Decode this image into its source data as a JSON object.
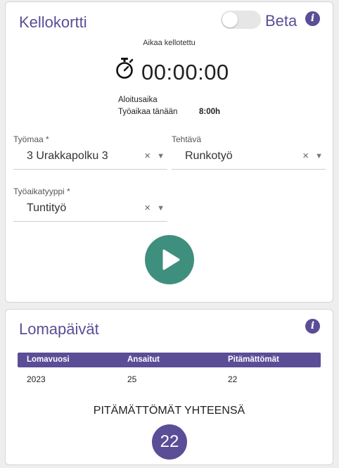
{
  "clock_card": {
    "title": "Kellokortti",
    "beta_label": "Beta",
    "beta_enabled": false,
    "info_icon": "i",
    "caption": "Aikaa kellotettu",
    "timer": "00:00:00",
    "start_time_label": "Aloitusaika",
    "start_time_value": "",
    "today_label": "Työaikaa tänään",
    "today_value": "8:00h",
    "fields": {
      "site": {
        "label": "Työmaa *",
        "value": "3 Urakkapolku 3",
        "clear": "×",
        "arrow": "▼"
      },
      "task": {
        "label": "Tehtävä",
        "value": "Runkotyö",
        "clear": "×",
        "arrow": "▼"
      },
      "worktype": {
        "label": "Työaikatyyppi *",
        "value": "Tuntityö",
        "clear": "×",
        "arrow": "▼"
      }
    },
    "play_icon": "play-icon"
  },
  "vacation_card": {
    "title": "Lomapäivät",
    "info_icon": "i",
    "table": {
      "headers": [
        "Lomavuosi",
        "Ansaitut",
        "Pitämättömät"
      ],
      "rows": [
        [
          "2023",
          "25",
          "22"
        ]
      ]
    },
    "total_label": "PITÄMÄTTÖMÄT YHTEENSÄ",
    "total_value": "22"
  },
  "colors": {
    "accent": "#5b4d96",
    "play_button": "#3f8f7e",
    "background": "#eeeeee"
  }
}
